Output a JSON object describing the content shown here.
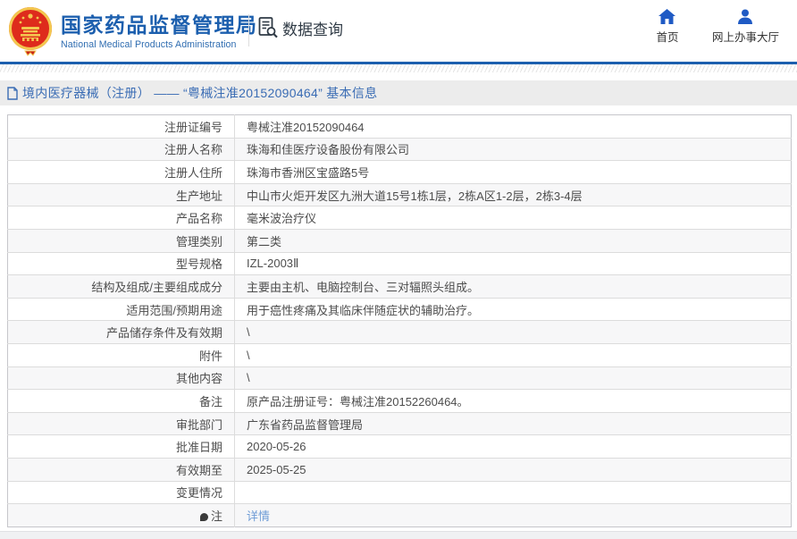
{
  "header": {
    "org_name_cn": "国家药品监督管理局",
    "org_name_en": "National Medical Products Administration",
    "section_label": "数据查询",
    "nav": {
      "home": "首页",
      "service_hall": "网上办事大厅"
    }
  },
  "breadcrumb": {
    "title": "境内医疗器械（注册） —— “粤械注准20152090464” 基本信息"
  },
  "table": {
    "rows": [
      {
        "label": "注册证编号",
        "value": "粤械注准20152090464"
      },
      {
        "label": "注册人名称",
        "value": "珠海和佳医疗设备股份有限公司"
      },
      {
        "label": "注册人住所",
        "value": "珠海市香洲区宝盛路5号"
      },
      {
        "label": "生产地址",
        "value": "中山市火炬开发区九洲大道15号1栋1层，2栋A区1-2层，2栋3-4层"
      },
      {
        "label": "产品名称",
        "value": "毫米波治疗仪"
      },
      {
        "label": "管理类别",
        "value": "第二类"
      },
      {
        "label": "型号规格",
        "value": "IZL-2003Ⅱ"
      },
      {
        "label": "结构及组成/主要组成成分",
        "value": "主要由主机、电脑控制台、三对辐照头组成。"
      },
      {
        "label": "适用范围/预期用途",
        "value": "用于癌性疼痛及其临床伴随症状的辅助治疗。"
      },
      {
        "label": "产品储存条件及有效期",
        "value": "\\"
      },
      {
        "label": "附件",
        "value": "\\"
      },
      {
        "label": "其他内容",
        "value": "\\"
      },
      {
        "label": "备注",
        "value": "原产品注册证号：粤械注准20152260464。"
      },
      {
        "label": "审批部门",
        "value": "广东省药品监督管理局"
      },
      {
        "label": "批准日期",
        "value": "2020-05-26"
      },
      {
        "label": "有效期至",
        "value": "2025-05-25"
      },
      {
        "label": "变更情况",
        "value": ""
      },
      {
        "label": "注",
        "value": "详情",
        "value_is_link": true,
        "label_icon": "note-pin-icon"
      }
    ]
  },
  "colors": {
    "brand_blue": "#1c5fae",
    "nav_icon_blue": "#1f5ac4",
    "crumb_bg": "#ececec",
    "crumb_text": "#3a6cb4",
    "link_blue": "#6f9cd6",
    "row_alt_bg": "#f7f7f8",
    "emblem_red": "#de2b1c",
    "emblem_gold": "#f3c74f"
  }
}
